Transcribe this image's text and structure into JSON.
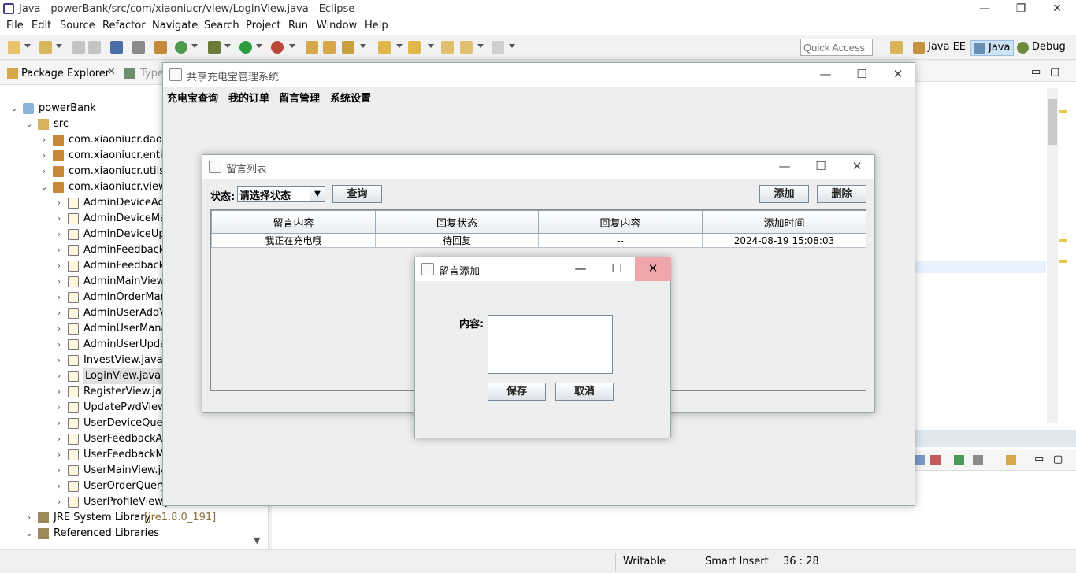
{
  "eclipse": {
    "window_title": "Java - powerBank/src/com/xiaoniucr/view/LoginView.java - Eclipse",
    "menu": [
      "File",
      "Edit",
      "Source",
      "Refactor",
      "Navigate",
      "Search",
      "Project",
      "Run",
      "Window",
      "Help"
    ],
    "quick_access": "Quick Access",
    "perspectives": [
      "Java EE",
      "Java",
      "Debug"
    ],
    "explorer_tab": "Package Explorer",
    "explorer_tab2": "Type",
    "tree": {
      "project": "powerBank",
      "src": "src",
      "packages": [
        "com.xiaoniucr.dao",
        "com.xiaoniucr.entity",
        "com.xiaoniucr.utils",
        "com.xiaoniucr.view"
      ],
      "files": [
        "AdminDeviceAdd",
        "AdminDeviceMan",
        "AdminDeviceUpd",
        "AdminFeedbackM",
        "AdminFeedbackR",
        "AdminMainView.j",
        "AdminOrderMan",
        "AdminUserAddVi",
        "AdminUserManag",
        "AdminUserUpdat",
        "InvestView.java",
        "LoginView.java",
        "RegisterView.java",
        "UpdatePwdView.j",
        "UserDeviceQuery",
        "UserFeedbackAd",
        "UserFeedbackMa",
        "UserMainView.jav",
        "UserOrderQuery\\",
        "UserProfileView.java"
      ],
      "jre": "JRE System Library",
      "jre_version": "[jre1.8.0_191]",
      "ref_libs": "Referenced Libraries"
    },
    "status": {
      "writable": "Writable",
      "insert": "Smart Insert",
      "position": "36 : 28"
    },
    "window_controls": {
      "min": "—",
      "max": "❐",
      "close": "✕"
    }
  },
  "main_window": {
    "title": "共享充电宝管理系统",
    "menu": [
      "充电宝查询",
      "我的订单",
      "留言管理",
      "系统设置"
    ]
  },
  "list_window": {
    "title": "留言列表",
    "status_label": "状态:",
    "status_select": "请选择状态",
    "query_btn": "查询",
    "add_btn": "添加",
    "delete_btn": "删除",
    "columns": [
      "留言内容",
      "回复状态",
      "回复内容",
      "添加时间"
    ],
    "rows": [
      [
        "我正在充电哦",
        "待回复",
        "--",
        "2024-08-19 15:08:03"
      ]
    ]
  },
  "add_dialog": {
    "title": "留言添加",
    "content_label": "内容:",
    "save_btn": "保存",
    "cancel_btn": "取消"
  }
}
